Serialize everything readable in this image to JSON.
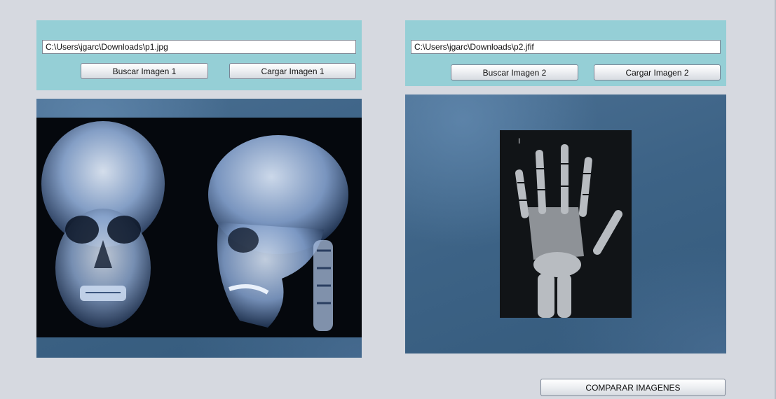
{
  "panel1": {
    "path_value": "C:\\Users\\jgarc\\Downloads\\p1.jpg",
    "search_button_label": "Buscar Imagen 1",
    "load_button_label": "Cargar Imagen 1",
    "image_icon": "skull-xray-image"
  },
  "panel2": {
    "path_value": "C:\\Users\\jgarc\\Downloads\\p2.jfif",
    "search_button_label": "Buscar Imagen 2",
    "load_button_label": "Cargar Imagen 2",
    "image_icon": "hand-xray-image",
    "image_marker": "I"
  },
  "compare_button_label": "COMPARAR IMAGENES",
  "colors": {
    "window_background": "#d6d9e0",
    "panel_background": "#95cfd6",
    "viewer_background": "#3d6386"
  }
}
